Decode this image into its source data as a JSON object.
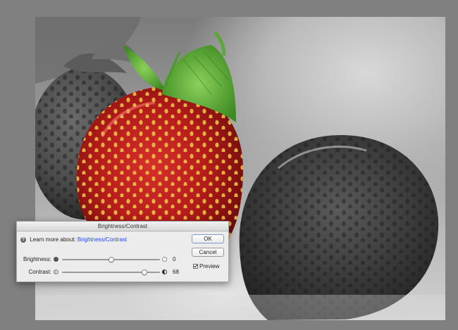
{
  "canvas": {
    "image_description_icon": "photo-icon"
  },
  "dialog": {
    "title": "Brightness/Contrast",
    "help_prefix": "Learn more about:",
    "help_link": "Brightness/Contrast",
    "help_icon": "help-icon",
    "brightness": {
      "label": "Brightness:",
      "value": "0",
      "level": 0.5
    },
    "contrast": {
      "label": "Contrast:",
      "value": "68",
      "level": 0.84
    },
    "ok_label": "OK",
    "cancel_label": "Cancel",
    "preview_label": "Preview",
    "preview_checked": true
  }
}
